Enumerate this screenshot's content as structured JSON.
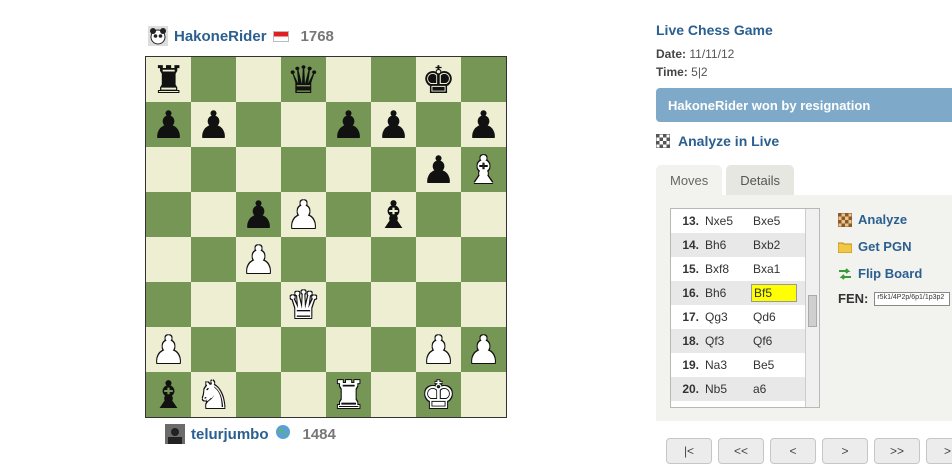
{
  "top_player": {
    "name": "HakoneRider",
    "rating": "1768"
  },
  "bottom_player": {
    "name": "telurjumbo",
    "rating": "1484"
  },
  "board": {
    "light_color": "#eeeed2",
    "dark_color": "#769656",
    "rows": [
      [
        "br",
        "",
        "",
        "bq",
        "",
        "",
        "bk",
        ""
      ],
      [
        "bp",
        "bp",
        "",
        "",
        "bp",
        "bp",
        "",
        "bp"
      ],
      [
        "",
        "",
        "",
        "",
        "",
        "",
        "bp",
        "wb"
      ],
      [
        "",
        "",
        "bp",
        "wp",
        "",
        "bb",
        "",
        ""
      ],
      [
        "",
        "",
        "wp",
        "",
        "",
        "",
        "",
        ""
      ],
      [
        "",
        "",
        "",
        "wq",
        "",
        "",
        "",
        ""
      ],
      [
        "wp",
        "",
        "",
        "",
        "",
        "",
        "wp",
        "wp"
      ],
      [
        "bb",
        "wn",
        "",
        "",
        "wr",
        "",
        "wk",
        ""
      ]
    ]
  },
  "game": {
    "title": "Live Chess Game",
    "date_label": "Date:",
    "date_value": "11/11/12",
    "time_label": "Time:",
    "time_value": "5|2",
    "result": "HakoneRider won by resignation",
    "analyze_live": "Analyze in Live"
  },
  "tabs": [
    "Moves",
    "Details"
  ],
  "moves": [
    {
      "num": "13.",
      "white": "Nxe5",
      "black": "Bxe5"
    },
    {
      "num": "14.",
      "white": "Bh6",
      "black": "Bxb2"
    },
    {
      "num": "15.",
      "white": "Bxf8",
      "black": "Bxa1"
    },
    {
      "num": "16.",
      "white": "Bh6",
      "black": "Bf5",
      "highlight": true
    },
    {
      "num": "17.",
      "white": "Qg3",
      "black": "Qd6"
    },
    {
      "num": "18.",
      "white": "Qf3",
      "black": "Qf6"
    },
    {
      "num": "19.",
      "white": "Na3",
      "black": "Be5"
    },
    {
      "num": "20.",
      "white": "Nb5",
      "black": "a6"
    }
  ],
  "actions": {
    "analyze": "Analyze",
    "get_pgn": "Get PGN",
    "flip_board": "Flip Board"
  },
  "fen": {
    "label": "FEN:",
    "value": "r5k1/4P2p/6p1/1p3p2"
  },
  "nav": [
    "|<",
    "<<",
    "<",
    ">",
    ">>",
    ">|"
  ],
  "icons": {
    "top_avatar": "panda-avatar-icon",
    "top_flag": "indonesia-flag-icon",
    "bottom_avatar": "user-photo-icon",
    "bottom_flag": "globe-icon",
    "analyze_live": "chessboard-icon",
    "analyze": "chessboard-icon",
    "get_pgn": "folder-icon",
    "flip_board": "flip-arrows-icon"
  }
}
